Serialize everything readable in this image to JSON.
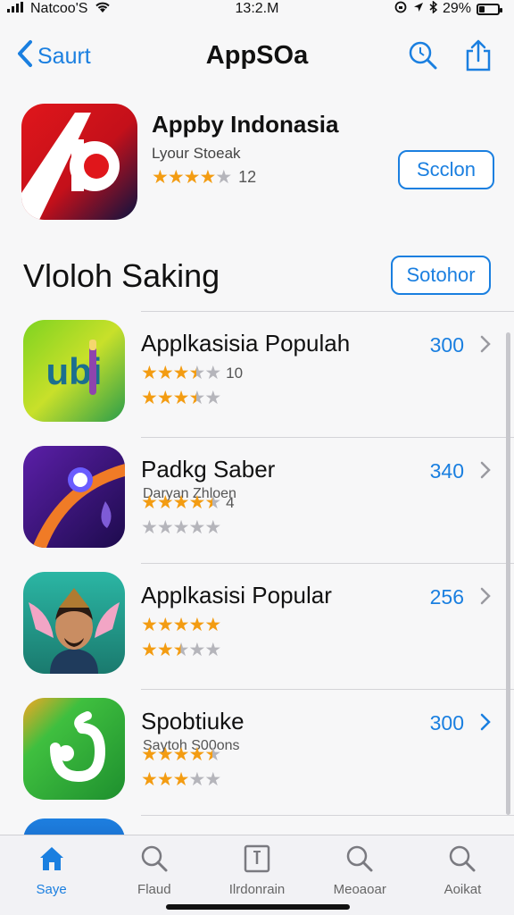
{
  "status_bar": {
    "carrier": "Natcoo'S",
    "time": "13:2.M",
    "battery": "29%",
    "battery_level": 0.29
  },
  "nav": {
    "back_label": "Saurt",
    "title": "AppSOa",
    "icons": [
      "search-icon",
      "share-icon"
    ]
  },
  "hero": {
    "title": "Appby Indonasia",
    "subtitle": "Lyour Stoeak",
    "rating": 4,
    "count": "12",
    "button_label": "Scclon",
    "accent_color": "#1a7fe0"
  },
  "section": {
    "title": "Vloloh Saking",
    "button_label": "Sotohor"
  },
  "apps": [
    {
      "title": "Applkasisia Populah",
      "subtitle": "",
      "rating_primary": 3.5,
      "count": "10",
      "rating_secondary": 3.5,
      "value": "300"
    },
    {
      "title": "Padkg Saber",
      "subtitle": "Daryan Zhloen",
      "rating_primary": 4.5,
      "count": "4",
      "rating_secondary": 0,
      "value": "340"
    },
    {
      "title": "Applkasisi Popular",
      "subtitle": "",
      "rating_primary": 5,
      "count": "",
      "rating_secondary": 2.5,
      "value": "256"
    },
    {
      "title": "Spobtiuke",
      "subtitle": "Saytoh S00ons",
      "rating_primary": 4.5,
      "count": "",
      "rating_secondary": 3,
      "value": "300"
    }
  ],
  "tabs": [
    {
      "label": "Saye",
      "icon": "home-icon",
      "active": true
    },
    {
      "label": "Flaud",
      "icon": "search-icon",
      "active": false
    },
    {
      "label": "Ilrdonrain",
      "icon": "grid-icon",
      "active": false
    },
    {
      "label": "Meoaoar",
      "icon": "search-icon",
      "active": false
    },
    {
      "label": "Aoikat",
      "icon": "search-icon",
      "active": false
    }
  ],
  "colors": {
    "accent": "#1a7fe0",
    "star": "#f39c12",
    "star_empty": "#b5b5bb"
  }
}
